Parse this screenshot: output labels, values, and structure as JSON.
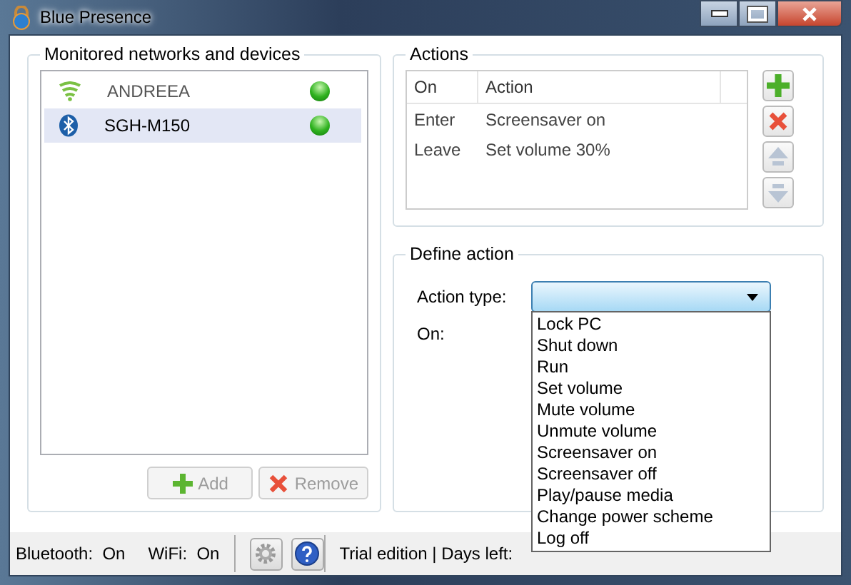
{
  "window": {
    "title": "Blue Presence"
  },
  "devices": {
    "title": "Monitored networks and devices",
    "items": [
      {
        "kind": "wifi",
        "name": "ANDREEA",
        "selected": false
      },
      {
        "kind": "bluetooth",
        "name": "SGH-M150",
        "selected": true
      }
    ],
    "buttons": [
      {
        "kind": "add",
        "label": "Add",
        "disabled": true
      },
      {
        "kind": "remove",
        "label": "Remove",
        "disabled": true
      }
    ]
  },
  "actions": {
    "title": "Actions",
    "columns": [
      "On",
      "Action"
    ],
    "rows": [
      [
        "Enter",
        "Screensaver on"
      ],
      [
        "Leave",
        "Set volume 30%"
      ]
    ]
  },
  "define_action": {
    "title": "Define action",
    "action_type_label": "Action type:",
    "on_label": "On:",
    "dropdown": {
      "expanded": true,
      "options": [
        "Lock PC",
        "Shut down",
        "Run",
        "Set volume",
        "Mute volume",
        "Unmute volume",
        "Screensaver on",
        "Screensaver off",
        "Play/pause media",
        "Change power scheme",
        "Log off"
      ]
    }
  },
  "status_bar": {
    "bluetooth_label": "Bluetooth:",
    "bluetooth_value": "On",
    "wifi_label": "WiFi:",
    "wifi_value": "On",
    "trial": "Trial edition | Days left:"
  }
}
